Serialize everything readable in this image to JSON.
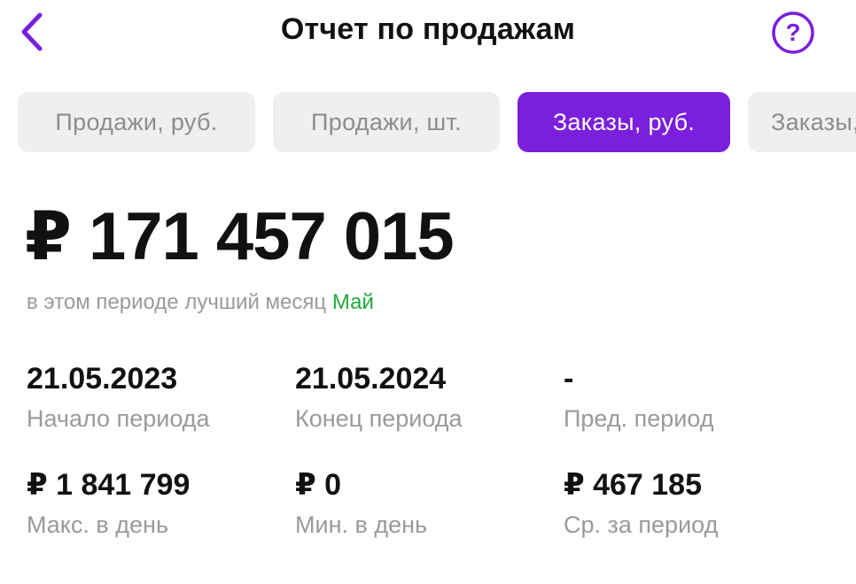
{
  "header": {
    "title": "Отчет по продажам",
    "back_icon": "chevron-left-icon",
    "help_icon": "question-circle-icon",
    "accent_color": "#7a1fdc"
  },
  "tabs": [
    {
      "label": "Продажи, руб.",
      "active": false
    },
    {
      "label": "Продажи, шт.",
      "active": false
    },
    {
      "label": "Заказы, руб.",
      "active": true
    },
    {
      "label": "Заказы, шт.",
      "active": false
    }
  ],
  "summary": {
    "amount": "₽ 171 457 015",
    "subtitle_prefix": "в этом периоде лучший месяц",
    "best_month": "Май",
    "best_month_color": "#1faa3a"
  },
  "stats": {
    "period_start": {
      "value": "21.05.2023",
      "label": "Начало периода"
    },
    "period_end": {
      "value": "21.05.2024",
      "label": "Конец периода"
    },
    "prev_period": {
      "value": "-",
      "label": "Пред. период"
    },
    "max_per_day": {
      "value": "₽ 1 841 799",
      "label": "Макс. в день"
    },
    "min_per_day": {
      "value": "₽ 0",
      "label": "Мин. в день"
    },
    "avg_per_period": {
      "value": "₽ 467 185",
      "label": "Ср. за период"
    }
  }
}
